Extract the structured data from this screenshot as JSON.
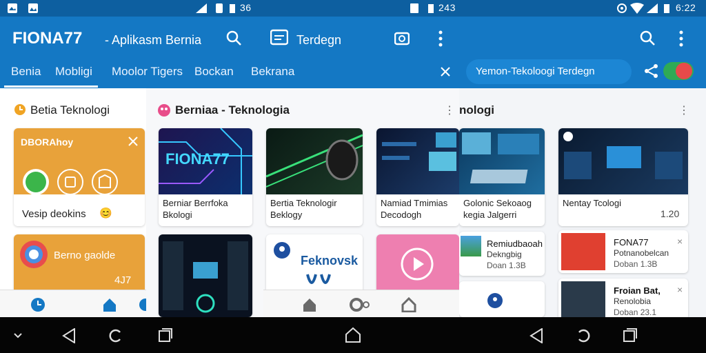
{
  "status": {
    "time_a": "36",
    "time_b": "243",
    "time_c": "6:22"
  },
  "appbar": {
    "title": "FIONA77",
    "subtitle": "- Aplikasm Bernia",
    "trending_label": "Terdegn",
    "tabs": [
      "Benia",
      "Mobligi",
      "Moolor Tigers",
      "Bockan",
      "Bekrana"
    ],
    "search_placeholder": "Yemon-Tekoloogi Terdegn"
  },
  "left_panel": {
    "section_title": "Betia Teknologi",
    "card1": {
      "label": "DBORAhoy",
      "caption": "Vesip deokins",
      "emoji": "😊"
    },
    "card2": {
      "label": "Berno gaolde",
      "count": "4J7"
    }
  },
  "middle_panel": {
    "section_title": "Berniaa - Teknologia",
    "cards": [
      {
        "thumb_text": "FIONA77",
        "caption": "Berniar Berrfoka\nBkologi"
      },
      {
        "caption": "Bertia Teknologir\nBeklogy"
      },
      {
        "caption": "Namiad Tmimias\nDecodogh"
      }
    ],
    "card4_text": "Feknovsk"
  },
  "right_panel": {
    "section_title": "nologi",
    "cards": [
      {
        "caption": "Golonic Sekoaog\nkegia Jalgerri"
      },
      {
        "caption": "Nentay Tcologi",
        "count": "1.20"
      }
    ],
    "list": [
      {
        "title": "Remiudbaoah",
        "sub": "Dekngbig",
        "meta": "Doan 1.3B",
        "close": "×"
      },
      {
        "title": "FONA77",
        "sub": "Potnanobelcan",
        "meta": "Doban 1.3B",
        "close": "×"
      },
      {
        "title": "Froian Bat,",
        "sub": "Renolobia",
        "meta": "Doban 23.1",
        "close": "×"
      }
    ]
  },
  "icons": {
    "search": "search-icon",
    "more": "more-vert-icon",
    "close": "close-icon",
    "share": "share-icon",
    "home": "home-icon",
    "back": "back-icon"
  },
  "colors": {
    "primary": "#1478c4",
    "status": "#0d5fa0",
    "accent_orange": "#e8a23a",
    "toggle_green": "#2faa55",
    "toggle_red": "#e74a4a"
  }
}
